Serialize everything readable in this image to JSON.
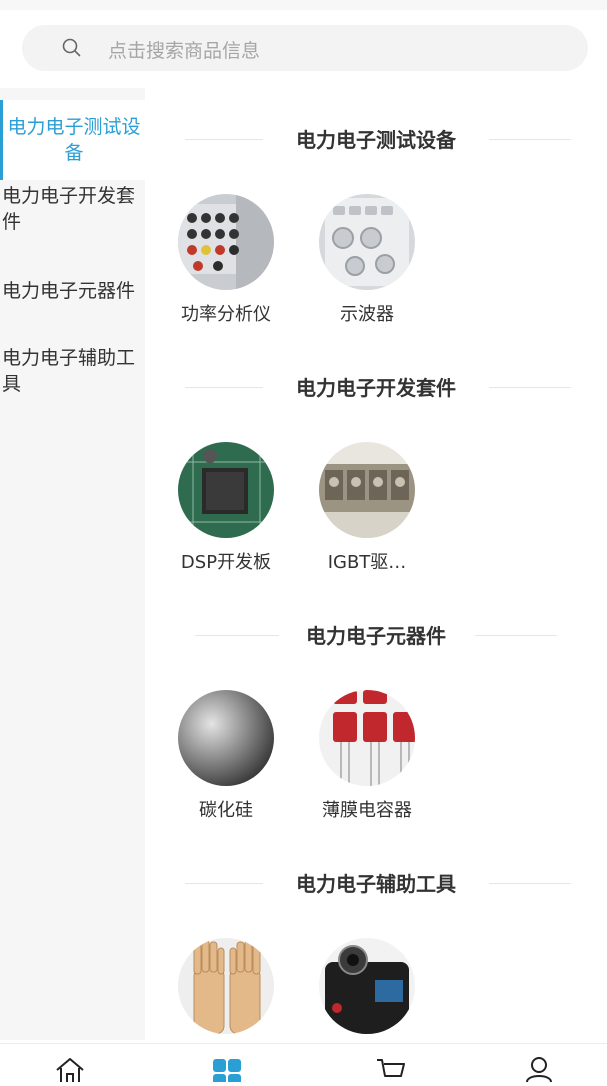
{
  "search": {
    "placeholder": "点击搜索商品信息"
  },
  "sidebar": {
    "items": [
      {
        "label": "电力电子测试设备",
        "active": true
      },
      {
        "label": "电力电子开发套件",
        "active": false
      },
      {
        "label": "电力电子元器件",
        "active": false
      },
      {
        "label": "电力电子辅助工具",
        "active": false
      }
    ]
  },
  "sections": [
    {
      "title": "电力电子测试设备",
      "items": [
        {
          "label": "功率分析仪",
          "icon": "power-analyzer"
        },
        {
          "label": "示波器",
          "icon": "oscilloscope"
        }
      ]
    },
    {
      "title": "电力电子开发套件",
      "items": [
        {
          "label": "DSP开发板",
          "icon": "dsp-board"
        },
        {
          "label": "IGBT驱…",
          "icon": "igbt-driver"
        }
      ]
    },
    {
      "title": "电力电子元器件",
      "items": [
        {
          "label": "碳化硅",
          "icon": "sic-wafer"
        },
        {
          "label": "薄膜电容器",
          "icon": "film-capacitor"
        }
      ]
    },
    {
      "title": "电力电子辅助工具",
      "items": [
        {
          "label": "",
          "icon": "insulating-gloves"
        },
        {
          "label": "",
          "icon": "thermal-camera"
        }
      ]
    }
  ],
  "tabbar": {
    "items": [
      {
        "icon": "home-icon",
        "active": false
      },
      {
        "icon": "category-icon",
        "active": true
      },
      {
        "icon": "cart-icon",
        "active": false
      },
      {
        "icon": "user-icon",
        "active": false
      }
    ]
  },
  "colors": {
    "accent": "#2a9fd6",
    "sidebar_bg": "#f6f6f6",
    "search_bg": "#f3f3f3"
  }
}
